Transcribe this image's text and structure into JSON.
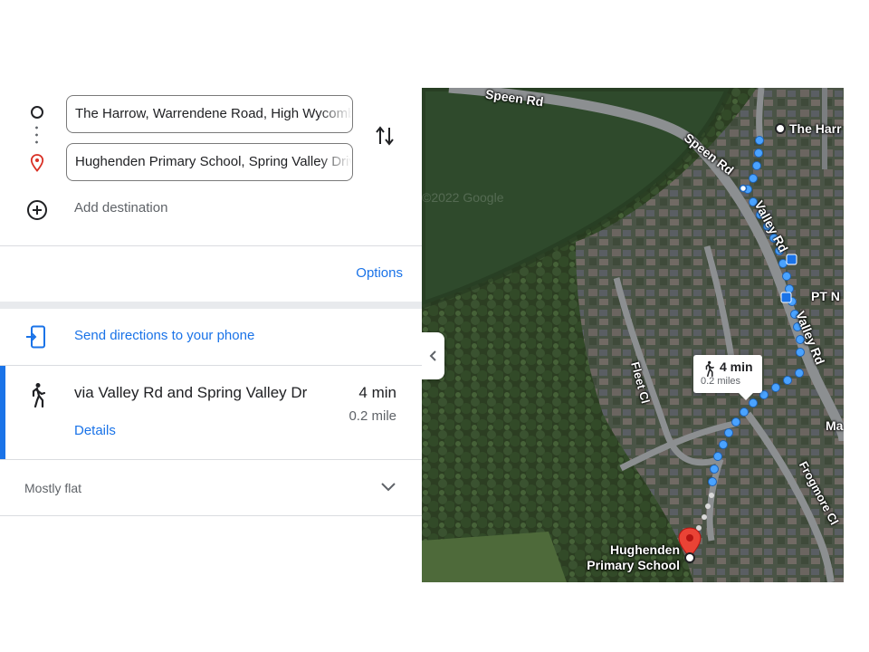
{
  "directions": {
    "origin_value": "The Harrow, Warrendene Road, High Wycombe",
    "destination_value": "Hughenden Primary School, Spring Valley Drive",
    "add_destination_label": "Add destination",
    "options_label": "Options",
    "send_to_phone_label": "Send directions to your phone"
  },
  "route": {
    "summary": "via Valley Rd and Spring Valley Dr",
    "duration": "4 min",
    "distance": "0.2 mile",
    "details_label": "Details",
    "terrain_note": "Mostly flat"
  },
  "map": {
    "callout_duration": "4 min",
    "callout_distance": "0.2 miles",
    "watermark": "©2022 Google",
    "origin_place_label": "The Harr",
    "destination_place_label": [
      "Hughenden",
      "Primary School"
    ],
    "streets": {
      "speen_rd_top": "Speen Rd",
      "speen_rd_diag": "Speen Rd",
      "valley_rd_upper": "Valley Rd",
      "valley_rd_lower": "Valley Rd",
      "fleet_cl": "Fleet Cl",
      "frogmore_cl": "Frogmore Cl",
      "pt_label": "PT N",
      "ma_label": "Ma"
    }
  },
  "colors": {
    "accent": "#1a73e8",
    "route_dots": "#4aa3ff",
    "destination_pin": "#ea4335"
  },
  "icons": {
    "origin": "origin-circle-icon",
    "destination": "destination-pin-icon",
    "swap": "swap-arrows-icon",
    "add": "add-circle-icon",
    "phone": "send-to-phone-icon",
    "walk": "walking-person-icon",
    "expand": "chevron-down-icon",
    "collapse": "chevron-left-icon"
  }
}
